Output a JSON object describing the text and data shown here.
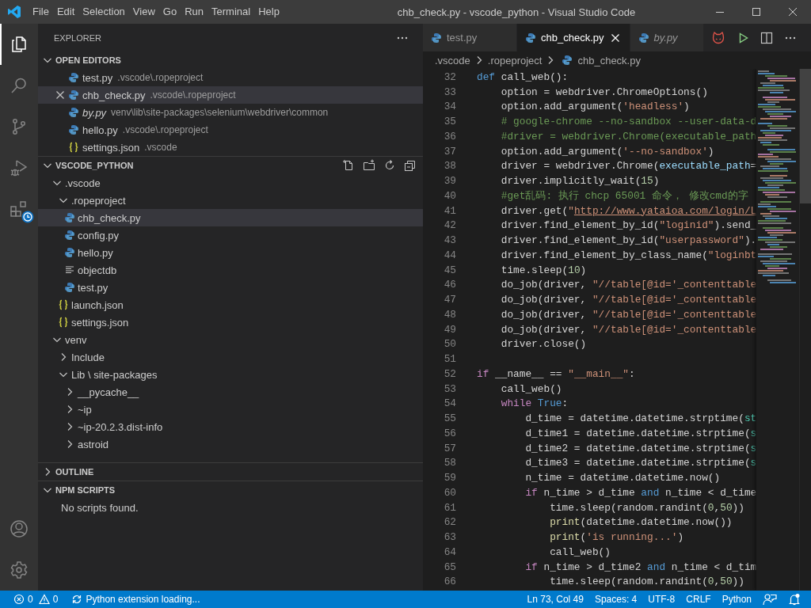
{
  "window": {
    "title": "chb_check.py - vscode_python - Visual Studio Code"
  },
  "menu": [
    "File",
    "Edit",
    "Selection",
    "View",
    "Go",
    "Run",
    "Terminal",
    "Help"
  ],
  "activity_bar": {
    "top": [
      {
        "kind": "explorer",
        "selected": true
      },
      {
        "kind": "search",
        "selected": false
      },
      {
        "kind": "source-control",
        "selected": false
      },
      {
        "kind": "run",
        "selected": false
      },
      {
        "kind": "extensions",
        "selected": false
      }
    ],
    "bottom": [
      {
        "kind": "account",
        "selected": false
      },
      {
        "kind": "settings",
        "selected": false
      }
    ]
  },
  "sidebar": {
    "title": "EXPLORER",
    "open_editors": {
      "title": "OPEN EDITORS",
      "expanded": true,
      "items": [
        {
          "name": "test.py",
          "path": ".vscode\\.ropeproject",
          "kind": "python",
          "preview": false,
          "selected": false
        },
        {
          "name": "chb_check.py",
          "path": ".vscode\\.ropeproject",
          "kind": "python",
          "preview": false,
          "selected": true
        },
        {
          "name": "by.py",
          "path": "venv\\lib\\site-packages\\selenium\\webdriver\\common",
          "kind": "python",
          "preview": true,
          "selected": false
        },
        {
          "name": "hello.py",
          "path": ".vscode\\.ropeproject",
          "kind": "python",
          "preview": false,
          "selected": false
        },
        {
          "name": "settings.json",
          "path": ".vscode",
          "kind": "json",
          "preview": false,
          "selected": false
        }
      ]
    },
    "folder": {
      "title": "VSCODE_PYTHON",
      "expanded": true,
      "items": [
        {
          "label": ".vscode",
          "kind": "folder",
          "expanded": true,
          "selected": false,
          "children": [
            {
              "label": ".ropeproject",
              "kind": "folder",
              "expanded": true,
              "selected": false,
              "children": [
                {
                  "label": "chb_check.py",
                  "kind": "python",
                  "selected": true
                },
                {
                  "label": "config.py",
                  "kind": "python",
                  "selected": false
                },
                {
                  "label": "hello.py",
                  "kind": "python",
                  "selected": false
                },
                {
                  "label": "objectdb",
                  "kind": "text",
                  "selected": false
                },
                {
                  "label": "test.py",
                  "kind": "python",
                  "selected": false
                }
              ]
            },
            {
              "label": "launch.json",
              "kind": "json",
              "selected": false
            },
            {
              "label": "settings.json",
              "kind": "json",
              "selected": false
            }
          ]
        },
        {
          "label": "venv",
          "kind": "folder",
          "expanded": true,
          "selected": false,
          "children": [
            {
              "label": "Include",
              "kind": "folder",
              "expanded": false,
              "selected": false
            },
            {
              "label": "Lib \\ site-packages",
              "kind": "folder",
              "expanded": true,
              "selected": false,
              "children": [
                {
                  "label": "__pycache__",
                  "kind": "folder",
                  "expanded": false,
                  "selected": false
                },
                {
                  "label": "~ip",
                  "kind": "folder",
                  "expanded": false,
                  "selected": false
                },
                {
                  "label": "~ip-20.2.3.dist-info",
                  "kind": "folder",
                  "expanded": false,
                  "selected": false
                },
                {
                  "label": "astroid",
                  "kind": "folder",
                  "expanded": false,
                  "selected": false
                }
              ]
            }
          ]
        }
      ]
    },
    "outline": {
      "title": "OUTLINE",
      "expanded": false
    },
    "npm_scripts": {
      "title": "NPM SCRIPTS",
      "expanded": true,
      "message": "No scripts found."
    }
  },
  "tabs": [
    {
      "label": "test.py",
      "selected": false,
      "preview": false
    },
    {
      "label": "chb_check.py",
      "selected": true,
      "preview": false
    },
    {
      "label": "by.py",
      "selected": false,
      "preview": true
    }
  ],
  "breadcrumbs": [
    {
      "label": ".vscode",
      "kind": "folder"
    },
    {
      "label": ".ropeproject",
      "kind": "folder"
    },
    {
      "label": "chb_check.py",
      "kind": "python"
    }
  ],
  "code": [
    {
      "number": "32",
      "tokens": [
        {
          "text": "def",
          "kind": "keyword"
        },
        {
          "text": " call_web():",
          "kind": "plain"
        }
      ]
    },
    {
      "number": "33",
      "tokens": [
        {
          "text": "    option = webdriver.ChromeOptions()",
          "kind": "plain"
        }
      ]
    },
    {
      "number": "34",
      "tokens": [
        {
          "text": "    option.add_argument(",
          "kind": "plain"
        },
        {
          "text": "'headless'",
          "kind": "string"
        },
        {
          "text": ")",
          "kind": "plain"
        }
      ]
    },
    {
      "number": "35",
      "tokens": [
        {
          "text": "    # google-chrome --no-sandbox --user-data-d",
          "kind": "comment"
        }
      ]
    },
    {
      "number": "36",
      "tokens": [
        {
          "text": "    #driver = webdriver.Chrome(executable_path",
          "kind": "comment"
        }
      ]
    },
    {
      "number": "37",
      "tokens": [
        {
          "text": "    option.add_argument(",
          "kind": "plain"
        },
        {
          "text": "'--no-sandbox'",
          "kind": "string"
        },
        {
          "text": ")",
          "kind": "plain"
        }
      ]
    },
    {
      "number": "38",
      "tokens": [
        {
          "text": "    driver = webdriver.Chrome(",
          "kind": "plain"
        },
        {
          "text": "executable_path",
          "kind": "param"
        },
        {
          "text": "=",
          "kind": "plain"
        }
      ]
    },
    {
      "number": "39",
      "tokens": [
        {
          "text": "    driver.implicitly_wait(",
          "kind": "plain"
        },
        {
          "text": "15",
          "kind": "number"
        },
        {
          "text": ")",
          "kind": "plain"
        }
      ]
    },
    {
      "number": "40",
      "tokens": [
        {
          "text": "    #get乱码: 执行 chcp 65001 命令， 修改cmd的字",
          "kind": "comment"
        }
      ]
    },
    {
      "number": "41",
      "tokens": [
        {
          "text": "    driver.get(",
          "kind": "plain"
        },
        {
          "text": "\"",
          "kind": "string"
        },
        {
          "text": "http://www.yataioa.com/login/L",
          "kind": "link"
        }
      ]
    },
    {
      "number": "42",
      "tokens": [
        {
          "text": "    driver.find_element_by_id(",
          "kind": "plain"
        },
        {
          "text": "\"loginid\"",
          "kind": "string"
        },
        {
          "text": ").send_",
          "kind": "plain"
        }
      ]
    },
    {
      "number": "43",
      "tokens": [
        {
          "text": "    driver.find_element_by_id(",
          "kind": "plain"
        },
        {
          "text": "\"userpassword\"",
          "kind": "string"
        },
        {
          "text": ").",
          "kind": "plain"
        }
      ]
    },
    {
      "number": "44",
      "tokens": [
        {
          "text": "    driver.find_element_by_class_name(",
          "kind": "plain"
        },
        {
          "text": "\"loginbt",
          "kind": "string"
        }
      ]
    },
    {
      "number": "45",
      "tokens": [
        {
          "text": "    time.sleep(",
          "kind": "plain"
        },
        {
          "text": "10",
          "kind": "number"
        },
        {
          "text": ")",
          "kind": "plain"
        }
      ]
    },
    {
      "number": "46",
      "tokens": [
        {
          "text": "    do_job(driver, ",
          "kind": "plain"
        },
        {
          "text": "\"//table[@id='_contenttable",
          "kind": "string"
        }
      ]
    },
    {
      "number": "47",
      "tokens": [
        {
          "text": "    do_job(driver, ",
          "kind": "plain"
        },
        {
          "text": "\"//table[@id='_contenttable",
          "kind": "string"
        }
      ]
    },
    {
      "number": "48",
      "tokens": [
        {
          "text": "    do_job(driver, ",
          "kind": "plain"
        },
        {
          "text": "\"//table[@id='_contenttable",
          "kind": "string"
        }
      ]
    },
    {
      "number": "49",
      "tokens": [
        {
          "text": "    do_job(driver, ",
          "kind": "plain"
        },
        {
          "text": "\"//table[@id='_contenttable",
          "kind": "string"
        }
      ]
    },
    {
      "number": "50",
      "tokens": [
        {
          "text": "    driver.close()",
          "kind": "plain"
        }
      ]
    },
    {
      "number": "51"
    },
    {
      "number": "52",
      "tokens": [
        {
          "text": "if",
          "kind": "control"
        },
        {
          "text": " __name__ == ",
          "kind": "plain"
        },
        {
          "text": "\"__main__\"",
          "kind": "string"
        },
        {
          "text": ":",
          "kind": "plain"
        }
      ]
    },
    {
      "number": "53",
      "tokens": [
        {
          "text": "    call_web()",
          "kind": "plain"
        }
      ]
    },
    {
      "number": "54",
      "tokens": [
        {
          "text": "    while",
          "kind": "control"
        },
        {
          "text": " True",
          "kind": "keyword"
        },
        {
          "text": ":",
          "kind": "plain"
        }
      ]
    },
    {
      "number": "55",
      "tokens": [
        {
          "text": "        d_time = datetime.datetime.strptime(",
          "kind": "plain"
        },
        {
          "text": "st",
          "kind": "type"
        }
      ]
    },
    {
      "number": "56",
      "tokens": [
        {
          "text": "        d_time1 = datetime.datetime.strptime(",
          "kind": "plain"
        },
        {
          "text": "s",
          "kind": "type"
        }
      ]
    },
    {
      "number": "57",
      "tokens": [
        {
          "text": "        d_time2 = datetime.datetime.strptime(",
          "kind": "plain"
        },
        {
          "text": "s",
          "kind": "type"
        }
      ]
    },
    {
      "number": "58",
      "tokens": [
        {
          "text": "        d_time3 = datetime.datetime.strptime(",
          "kind": "plain"
        },
        {
          "text": "s",
          "kind": "type"
        }
      ]
    },
    {
      "number": "59",
      "tokens": [
        {
          "text": "        n_time = datetime.datetime.now()",
          "kind": "plain"
        }
      ]
    },
    {
      "number": "60",
      "tokens": [
        {
          "text": "        if",
          "kind": "control"
        },
        {
          "text": " n_time > d_time ",
          "kind": "plain"
        },
        {
          "text": "and",
          "kind": "keyword"
        },
        {
          "text": " n_time < d_time",
          "kind": "plain"
        }
      ]
    },
    {
      "number": "61",
      "tokens": [
        {
          "text": "            time.sleep(random.randint(",
          "kind": "plain"
        },
        {
          "text": "0",
          "kind": "number"
        },
        {
          "text": ",",
          "kind": "plain"
        },
        {
          "text": "50",
          "kind": "number"
        },
        {
          "text": "))",
          "kind": "plain"
        }
      ]
    },
    {
      "number": "62",
      "tokens": [
        {
          "text": "            print",
          "kind": "func"
        },
        {
          "text": "(datetime.datetime.now())",
          "kind": "plain"
        }
      ]
    },
    {
      "number": "63",
      "tokens": [
        {
          "text": "            print",
          "kind": "func"
        },
        {
          "text": "(",
          "kind": "plain"
        },
        {
          "text": "'is running...'",
          "kind": "string"
        },
        {
          "text": ")",
          "kind": "plain"
        }
      ]
    },
    {
      "number": "64",
      "tokens": [
        {
          "text": "            call_web()",
          "kind": "plain"
        }
      ]
    },
    {
      "number": "65",
      "tokens": [
        {
          "text": "        if",
          "kind": "control"
        },
        {
          "text": " n_time > d_time2 ",
          "kind": "plain"
        },
        {
          "text": "and",
          "kind": "keyword"
        },
        {
          "text": " n_time < d_tim",
          "kind": "plain"
        }
      ]
    },
    {
      "number": "66",
      "tokens": [
        {
          "text": "            time.sleep(random.randint(",
          "kind": "plain"
        },
        {
          "text": "0",
          "kind": "number"
        },
        {
          "text": ",",
          "kind": "plain"
        },
        {
          "text": "50",
          "kind": "number"
        },
        {
          "text": "))",
          "kind": "plain"
        }
      ]
    }
  ],
  "status_bar": {
    "errors": "0",
    "warnings": "0",
    "message": "Python extension loading...",
    "items": [
      "Ln 73, Col 49",
      "Spaces: 4",
      "UTF-8",
      "CRLF",
      "Python"
    ]
  }
}
